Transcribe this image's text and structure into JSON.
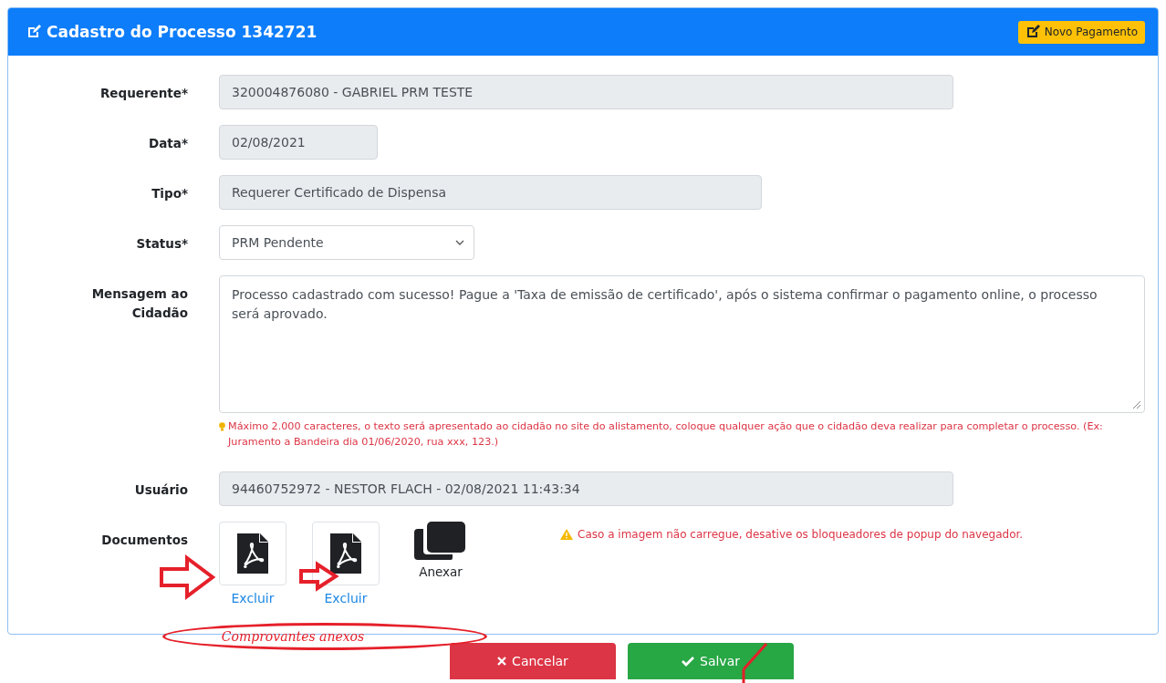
{
  "header": {
    "title": "Cadastro do Processo 1342721",
    "action": "Novo Pagamento"
  },
  "fields": [
    {
      "kind": "text",
      "label": "Requerente*",
      "value": "320004876080 - GABRIEL PRM TESTE"
    },
    {
      "kind": "text",
      "label": "Data*",
      "value": "02/08/2021"
    },
    {
      "kind": "text",
      "label": "Tipo*",
      "value": "Requerer Certificado de Dispensa"
    },
    {
      "kind": "select",
      "label": "Status*",
      "value": "PRM Pendente"
    },
    {
      "kind": "textarea",
      "label": "Mensagem ao Cidadão",
      "value": "Processo cadastrado com sucesso! Pague a 'Taxa de emissão de certificado', após o sistema confirmar o pagamento online, o processo será aprovado.",
      "hint": "Máximo 2.000 caracteres, o texto será apresentado ao cidadão no site do alistamento, coloque qualquer ação que o cidadão deva realizar para completar o processo. (Ex: Juramento a Bandeira dia 01/06/2020, rua xxx, 123.)"
    },
    {
      "kind": "text",
      "label": "Usuário",
      "value": "94460752972 - NESTOR FLACH - 02/08/2021 11:43:34"
    },
    {
      "kind": "documents",
      "label": "Documentos",
      "files": [
        {
          "action": "Excluir"
        },
        {
          "action": "Excluir"
        }
      ],
      "attach": "Anexar",
      "warning": "Caso a imagem não carregue, desative os bloqueadores de popup do navegador."
    }
  ],
  "annotation": {
    "text": "Comprovantes anexos"
  },
  "buttons": [
    {
      "kind": "cancel",
      "label": "Cancelar"
    },
    {
      "kind": "save",
      "label": "Salvar"
    }
  ]
}
